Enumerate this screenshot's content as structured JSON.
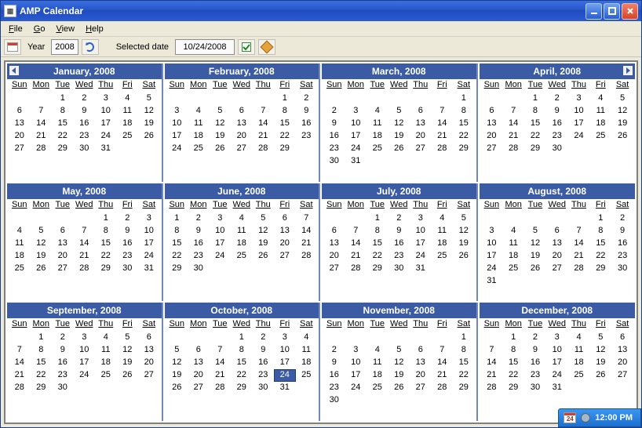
{
  "window": {
    "title": "AMP Calendar"
  },
  "menu": {
    "file": "File",
    "go": "Go",
    "view": "View",
    "help": "Help"
  },
  "toolbar": {
    "year_label": "Year",
    "year_value": "2008",
    "sel_label": "Selected date",
    "sel_value": "10/24/2008"
  },
  "dow": [
    "Sun",
    "Mon",
    "Tue",
    "Wed",
    "Thu",
    "Fri",
    "Sat"
  ],
  "months": [
    {
      "title": "January, 2008",
      "offset": 2,
      "days": 31
    },
    {
      "title": "February, 2008",
      "offset": 5,
      "days": 29
    },
    {
      "title": "March, 2008",
      "offset": 6,
      "days": 31
    },
    {
      "title": "April, 2008",
      "offset": 2,
      "days": 30
    },
    {
      "title": "May, 2008",
      "offset": 4,
      "days": 31
    },
    {
      "title": "June, 2008",
      "offset": 0,
      "days": 30
    },
    {
      "title": "July, 2008",
      "offset": 2,
      "days": 31
    },
    {
      "title": "August, 2008",
      "offset": 5,
      "days": 31
    },
    {
      "title": "September, 2008",
      "offset": 1,
      "days": 30
    },
    {
      "title": "October, 2008",
      "offset": 3,
      "days": 31,
      "selected": 24
    },
    {
      "title": "November, 2008",
      "offset": 6,
      "days": 30
    },
    {
      "title": "December, 2008",
      "offset": 1,
      "days": 31
    }
  ],
  "tray": {
    "date_badge": "24",
    "time": "12:00 PM"
  }
}
